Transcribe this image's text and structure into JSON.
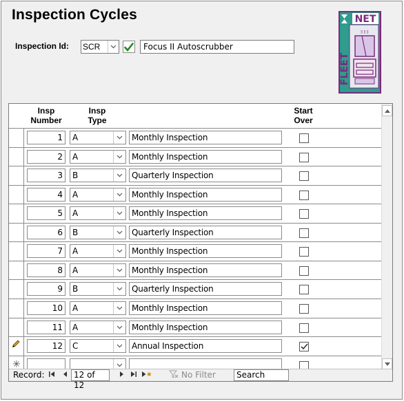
{
  "title": "Inspection Cycles",
  "inspection_id": {
    "label": "Inspection Id:",
    "value": "SCR",
    "description": "Focus II Autoscrubber"
  },
  "logo": {
    "top_text": "NET",
    "side_text": "FLEET"
  },
  "columns": {
    "number": [
      "Insp",
      "Number"
    ],
    "type": [
      "Insp",
      "Type"
    ],
    "start_over": [
      "Start",
      "Over"
    ]
  },
  "rows": [
    {
      "number": "1",
      "type": "A",
      "description": "Monthly Inspection",
      "start_over": false
    },
    {
      "number": "2",
      "type": "A",
      "description": "Monthly Inspection",
      "start_over": false
    },
    {
      "number": "3",
      "type": "B",
      "description": "Quarterly Inspection",
      "start_over": false
    },
    {
      "number": "4",
      "type": "A",
      "description": "Monthly Inspection",
      "start_over": false
    },
    {
      "number": "5",
      "type": "A",
      "description": "Monthly Inspection",
      "start_over": false
    },
    {
      "number": "6",
      "type": "B",
      "description": "Quarterly Inspection",
      "start_over": false
    },
    {
      "number": "7",
      "type": "A",
      "description": "Monthly Inspection",
      "start_over": false
    },
    {
      "number": "8",
      "type": "A",
      "description": "Monthly Inspection",
      "start_over": false
    },
    {
      "number": "9",
      "type": "B",
      "description": "Quarterly Inspection",
      "start_over": false
    },
    {
      "number": "10",
      "type": "A",
      "description": "Monthly Inspection",
      "start_over": false
    },
    {
      "number": "11",
      "type": "A",
      "description": "Monthly Inspection",
      "start_over": false
    },
    {
      "number": "12",
      "type": "C",
      "description": "Annual Inspection",
      "start_over": true
    }
  ],
  "new_row": {
    "number": "",
    "type": "",
    "description": "",
    "start_over": false
  },
  "navigation": {
    "record_label": "Record:",
    "position": "12 of 12",
    "filter_label": "No Filter",
    "search_placeholder": "Search"
  }
}
